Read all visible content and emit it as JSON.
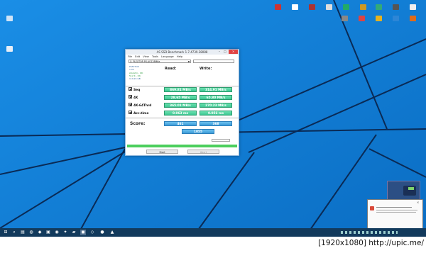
{
  "window": {
    "title": "AS SSD Benchmark 1.7.4739.38088",
    "menu": [
      "File",
      "Edit",
      "View",
      "Tools",
      "Language",
      "Help"
    ],
    "drive_select": "C: PLEXTOR PX-AG128M6e",
    "drive_info": [
      "PLEXTOR",
      "1.04",
      "storahci - OK",
      "512 K - OK",
      "119.24 GB"
    ],
    "read_header": "Read:",
    "write_header": "Write:",
    "rows": [
      {
        "label": "Seq",
        "read": "869.81 MB/s",
        "write": "314.91 MB/s"
      },
      {
        "label": "4K",
        "read": "28.65 MB/s",
        "write": "65.80 MB/s"
      },
      {
        "label": "4K-64Thrd",
        "read": "365.01 MB/s",
        "write": "270.23 MB/s"
      },
      {
        "label": "Acc.time",
        "read": "0.063 ms",
        "write": "0.056 ms"
      }
    ],
    "score_label": "Score:",
    "score_read": "461",
    "score_write": "368",
    "score_total": "1055",
    "progress_fraction": 1.0,
    "start_label": "Start",
    "abort_label": "Abort"
  },
  "taskbar": {
    "time": "",
    "date": ""
  },
  "watermark": "[1920x1080] http://upic.me/",
  "notification": {
    "title": "",
    "body": ""
  }
}
